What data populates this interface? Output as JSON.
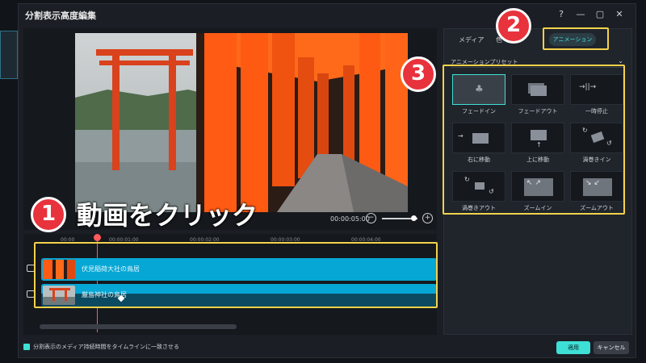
{
  "dialog": {
    "title": "分割表示高度編集",
    "help_icon": "help-circle-icon",
    "window_buttons": [
      "minimize-icon",
      "maximize-icon",
      "close-icon"
    ]
  },
  "player": {
    "timecode": "00:00:05:00",
    "zoom_minus": "⊖",
    "zoom_plus": "⊕"
  },
  "timeline": {
    "ruler_labels": [
      "00:00",
      "00:00:01:00",
      "00:00:02:00",
      "00:00:03:00",
      "00:00:04:00"
    ],
    "tracks": [
      {
        "label": "伏見稲荷大社の鳥居"
      },
      {
        "label": "厳島神社の鳥居"
      }
    ]
  },
  "right_panel": {
    "tabs": [
      {
        "label": "メディア",
        "active": false
      },
      {
        "label": "色",
        "active": false
      },
      {
        "label": "アニメーション",
        "active": true
      }
    ],
    "preset_label": "アニメーションプリセット",
    "presets": [
      {
        "label": "フェードイン",
        "selected": true
      },
      {
        "label": "フェードアウト",
        "selected": false
      },
      {
        "label": "一時停止",
        "selected": false
      },
      {
        "label": "右に移動",
        "selected": false
      },
      {
        "label": "上に移動",
        "selected": false
      },
      {
        "label": "渦巻きイン",
        "selected": false
      },
      {
        "label": "渦巻きアウト",
        "selected": false
      },
      {
        "label": "ズームイン",
        "selected": false
      },
      {
        "label": "ズームアウト",
        "selected": false
      }
    ]
  },
  "footer": {
    "sync_label": "分割表示のメディア持続時間をタイムラインに一致させる",
    "sync_checked": true,
    "apply_label": "適用",
    "cancel_label": "キャンセル"
  },
  "annotations": {
    "badge1": "1",
    "badge2": "2",
    "badge3": "3",
    "instruction": "動画をクリック"
  },
  "colors": {
    "accent": "#3ee0d6",
    "clip": "#06a7d4",
    "highlight": "#f4d24a",
    "badge": "#e8323c"
  }
}
